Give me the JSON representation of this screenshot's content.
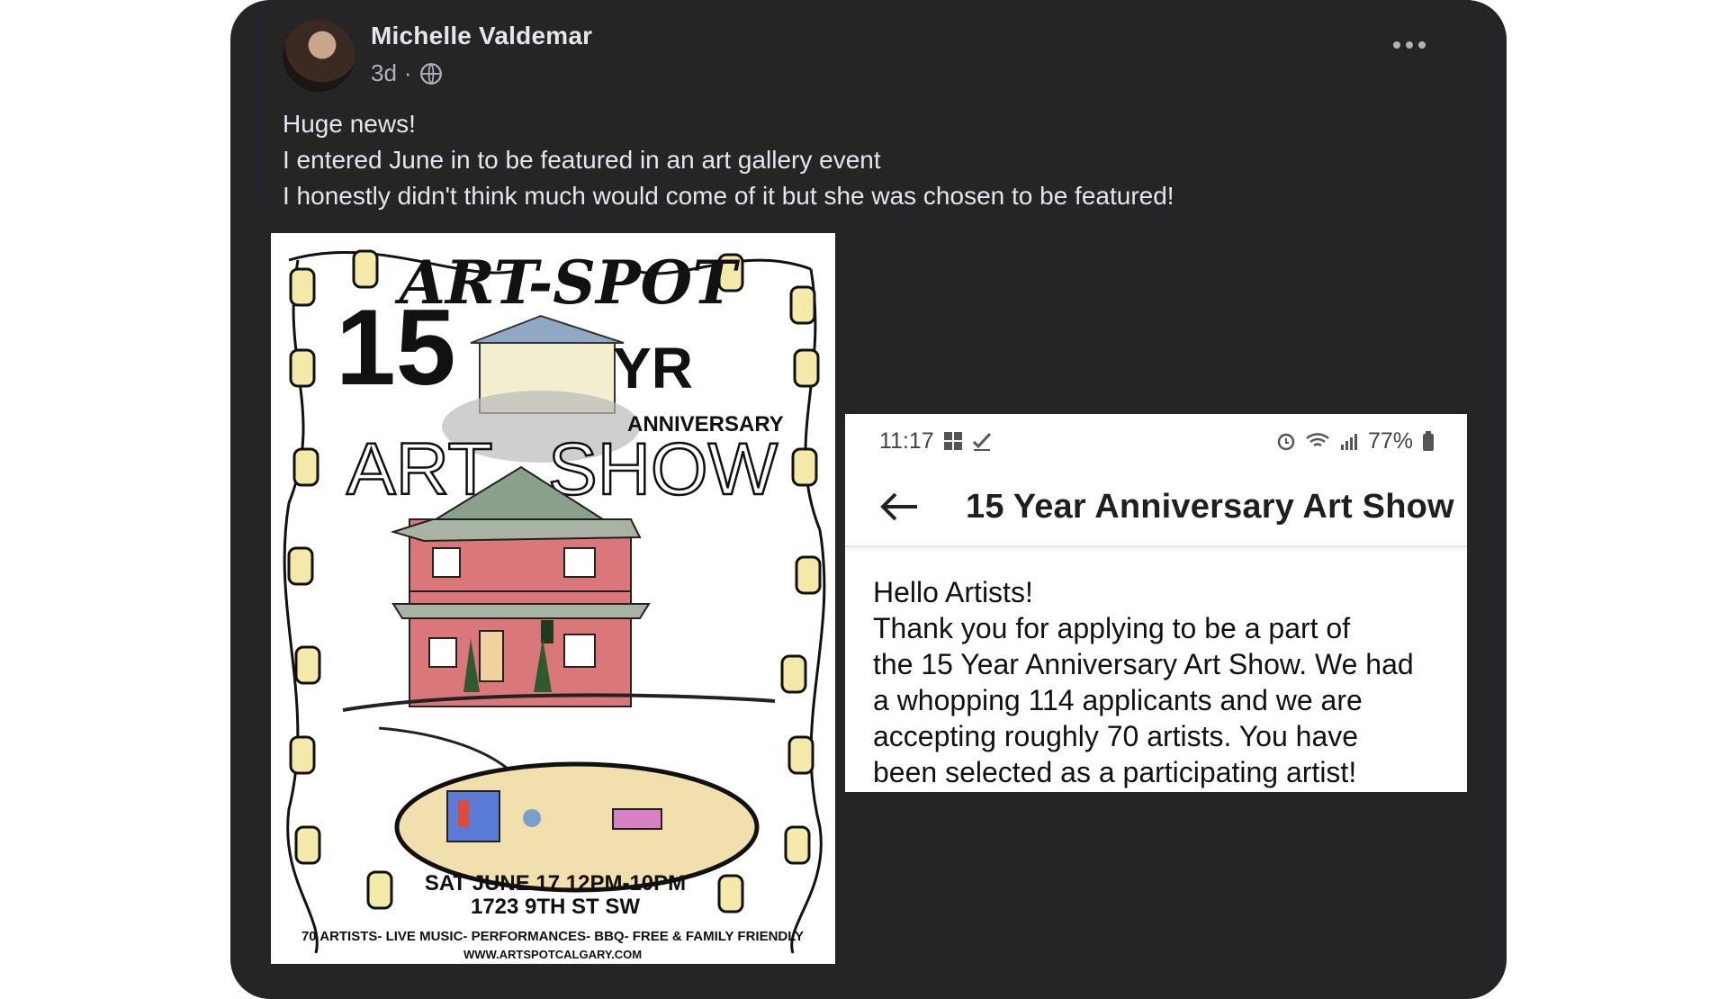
{
  "post": {
    "author": "Michelle Valdemar",
    "age": "3d",
    "separator": "·",
    "privacy_icon": "globe-icon",
    "more_icon": "more-options-icon",
    "lines": [
      "Huge news!",
      "I entered June in to be featured in an art gallery event",
      "I honestly didn't think much would come of it but she was chosen to be featured!"
    ]
  },
  "poster": {
    "logo": "ART-SPOT",
    "number": "15",
    "yr": "YR",
    "anniversary": "ANNIVERSARY",
    "art": "ART",
    "show": "SHOW",
    "date": "SAT JUNE 17 12PM-10PM",
    "address": "1723 9TH ST SW",
    "features": "70 ARTISTS- LIVE MUSIC- PERFORMANCES- BBQ- FREE & FAMILY FRIENDLY",
    "website": "WWW.ARTSPOTCALGARY.COM"
  },
  "screenshot": {
    "status": {
      "time": "11:17",
      "battery": "77%"
    },
    "title": "15 Year Anniversary Art Show",
    "message": [
      "Hello Artists!",
      "Thank you for applying to be a part of",
      "the 15 Year Anniversary Art Show. We had",
      "a whopping 114 applicants and we are",
      "accepting roughly 70 artists. You have",
      "been selected as a participating artist!"
    ]
  },
  "colors": {
    "card": "#242526",
    "text": "#e4e6eb",
    "muted": "#b0b3b8",
    "house": "#d9777a"
  }
}
